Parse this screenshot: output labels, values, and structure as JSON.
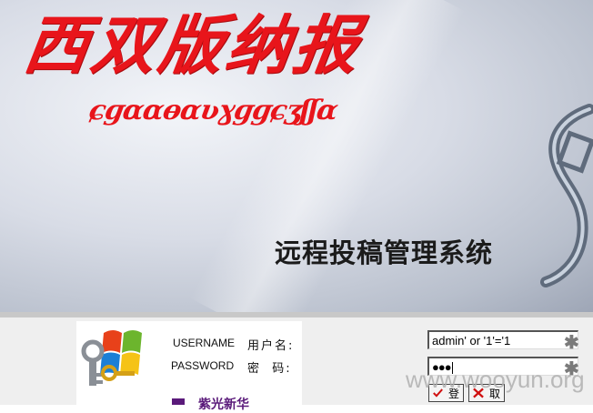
{
  "banner": {
    "brand_title": "西双版纳报",
    "brand_script": "ɕɡɑɑɵɑʋɣɡɡɕʒʃʃɑ",
    "system_title": "远程投稿管理系统"
  },
  "login": {
    "username_en": "USERNAME",
    "username_cn": "用户名:",
    "password_en": "PASSWORD",
    "password_cn": "密  码:",
    "username_value": "admin' or '1'='1",
    "password_mask": "●●●",
    "required_mark": "✱",
    "login_button": "登",
    "cancel_button": "取",
    "footer_text": "紫光新华"
  },
  "watermark": "www.wooyun.org",
  "icons": [
    "windows-keys-icon",
    "check-icon",
    "cross-icon",
    "s-logo-icon"
  ],
  "colors": {
    "brand_red": "#e8151b",
    "purple": "#5a1a7a"
  }
}
